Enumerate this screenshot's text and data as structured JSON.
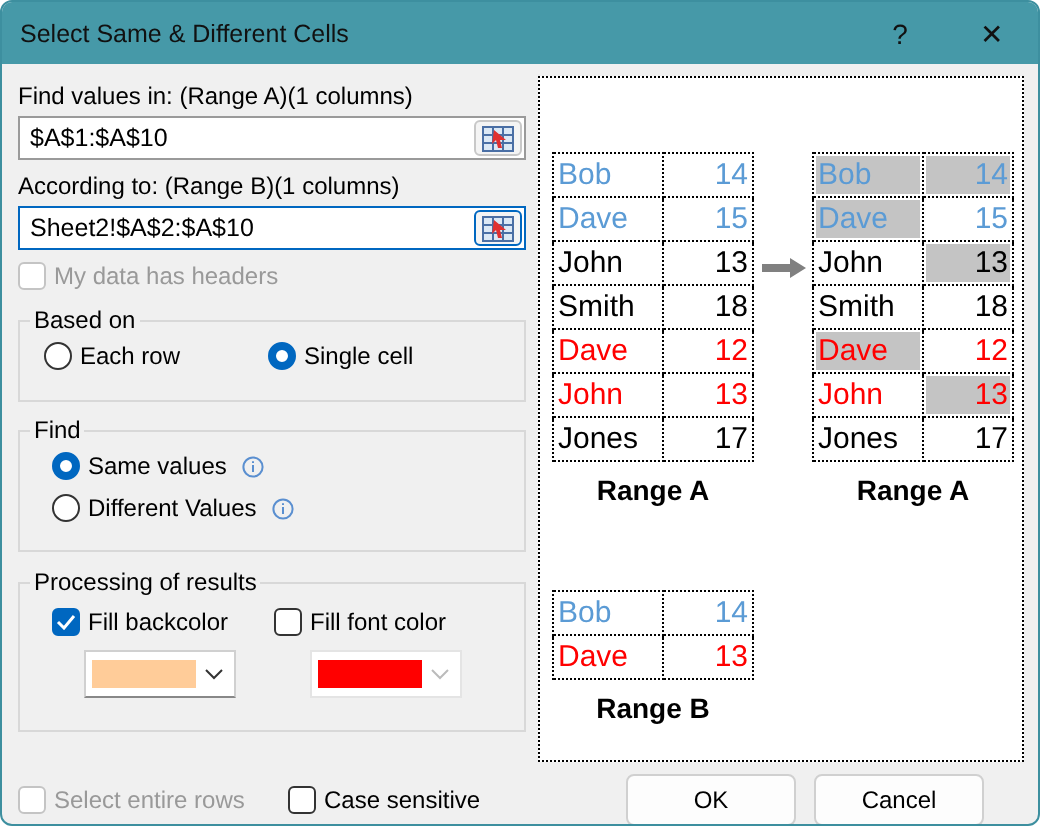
{
  "window": {
    "title": "Select Same & Different Cells",
    "help": "?",
    "close": "✕"
  },
  "range_a": {
    "label": "Find values in: (Range A)(1 columns)",
    "value": "$A$1:$A$10",
    "focused": false
  },
  "range_b": {
    "label": "According to: (Range B)(1 columns)",
    "value": "Sheet2!$A$2:$A$10",
    "focused": true
  },
  "headers_checkbox": {
    "label": "My data has headers",
    "checked": false,
    "disabled": true
  },
  "based_on": {
    "title": "Based on",
    "options": [
      {
        "label": "Each row",
        "selected": false
      },
      {
        "label": "Single cell",
        "selected": true
      }
    ]
  },
  "find": {
    "title": "Find",
    "options": [
      {
        "label": "Same values",
        "selected": true
      },
      {
        "label": "Different Values",
        "selected": false
      }
    ]
  },
  "processing": {
    "title": "Processing of results",
    "fills": [
      {
        "label": "Fill backcolor",
        "checked": true,
        "color": "#ffcc99"
      },
      {
        "label": "Fill font color",
        "checked": false,
        "color": "#ff0000"
      }
    ]
  },
  "options": [
    {
      "label": "Select entire rows",
      "checked": false,
      "disabled": true
    },
    {
      "label": "Case sensitive",
      "checked": false,
      "disabled": false
    }
  ],
  "preview": {
    "tables": [
      {
        "caption": "Range A",
        "rows": [
          {
            "name": "Bob",
            "value": "14",
            "color": "#5b9bd5",
            "name_highlighted": false,
            "value_highlighted": false
          },
          {
            "name": "Dave",
            "value": "15",
            "color": "#5b9bd5",
            "name_highlighted": false,
            "value_highlighted": false
          },
          {
            "name": "John",
            "value": "13",
            "color": "#000000",
            "name_highlighted": false,
            "value_highlighted": false
          },
          {
            "name": "Smith",
            "value": "18",
            "color": "#000000",
            "name_highlighted": false,
            "value_highlighted": false
          },
          {
            "name": "Dave",
            "value": "12",
            "color": "#ff0000",
            "name_highlighted": false,
            "value_highlighted": false
          },
          {
            "name": "John",
            "value": "13",
            "color": "#ff0000",
            "name_highlighted": false,
            "value_highlighted": false
          },
          {
            "name": "Jones",
            "value": "17",
            "color": "#000000",
            "name_highlighted": false,
            "value_highlighted": false
          }
        ]
      },
      {
        "caption": "Range A",
        "rows": [
          {
            "name": "Bob",
            "value": "14",
            "color": "#5b9bd5",
            "name_highlighted": true,
            "value_highlighted": true
          },
          {
            "name": "Dave",
            "value": "15",
            "color": "#5b9bd5",
            "name_highlighted": true,
            "value_highlighted": false
          },
          {
            "name": "John",
            "value": "13",
            "color": "#000000",
            "name_highlighted": false,
            "value_highlighted": true
          },
          {
            "name": "Smith",
            "value": "18",
            "color": "#000000",
            "name_highlighted": false,
            "value_highlighted": false
          },
          {
            "name": "Dave",
            "value": "12",
            "color": "#ff0000",
            "name_highlighted": true,
            "value_highlighted": false
          },
          {
            "name": "John",
            "value": "13",
            "color": "#ff0000",
            "name_highlighted": false,
            "value_highlighted": true
          },
          {
            "name": "Jones",
            "value": "17",
            "color": "#000000",
            "name_highlighted": false,
            "value_highlighted": false
          }
        ]
      }
    ],
    "range_b": {
      "caption": "Range B",
      "rows": [
        {
          "name": "Bob",
          "value": "14",
          "color": "#5b9bd5",
          "name_highlighted": false,
          "value_highlighted": false
        },
        {
          "name": "Dave",
          "value": "13",
          "color": "#ff0000",
          "name_highlighted": false,
          "value_highlighted": false
        }
      ]
    }
  },
  "buttons": [
    {
      "label": "OK"
    },
    {
      "label": "Cancel"
    }
  ]
}
